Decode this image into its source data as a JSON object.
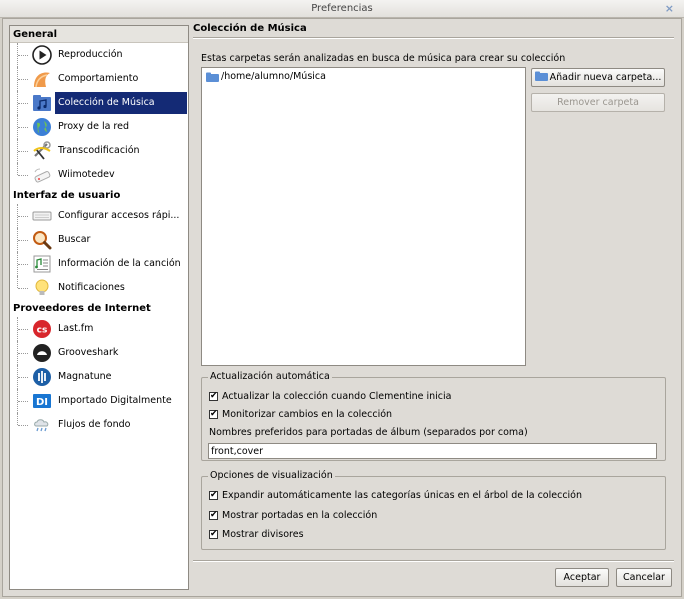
{
  "window": {
    "title": "Preferencias",
    "close_glyph": "×"
  },
  "sidebar": {
    "groups": [
      {
        "label": "General",
        "items": [
          {
            "label": "Reproducción",
            "icon": "play-icon"
          },
          {
            "label": "Comportamiento",
            "icon": "behaviour-icon"
          },
          {
            "label": "Colección de Música",
            "icon": "music-library-icon",
            "selected": true
          },
          {
            "label": "Proxy de la red",
            "icon": "globe-icon"
          },
          {
            "label": "Transcodificación",
            "icon": "transcode-icon"
          },
          {
            "label": "Wiimotedev",
            "icon": "wiimote-icon"
          }
        ]
      },
      {
        "label": "Interfaz de usuario",
        "items": [
          {
            "label": "Configurar accesos rápi...",
            "icon": "keyboard-icon"
          },
          {
            "label": "Buscar",
            "icon": "magnifier-icon"
          },
          {
            "label": "Información de la canción",
            "icon": "song-info-icon"
          },
          {
            "label": "Notificaciones",
            "icon": "lightbulb-icon"
          }
        ]
      },
      {
        "label": "Proveedores de Internet",
        "items": [
          {
            "label": "Last.fm",
            "icon": "lastfm-icon"
          },
          {
            "label": "Grooveshark",
            "icon": "grooveshark-icon"
          },
          {
            "label": "Magnatune",
            "icon": "magnatune-icon"
          },
          {
            "label": "Importado Digitalmente",
            "icon": "digitally-imported-icon"
          },
          {
            "label": "Flujos de fondo",
            "icon": "background-streams-icon"
          }
        ]
      }
    ]
  },
  "main": {
    "title": "Colección de Música",
    "description": "Estas carpetas serán analizadas en busca de música para crear su colección",
    "folders": [
      "/home/alumno/Música"
    ],
    "add_folder_button": "Añadir nueva carpeta...",
    "remove_folder_button": "Remover carpeta",
    "auto_update": {
      "legend": "Actualización automática",
      "update_on_start": {
        "label": "Actualizar la colección cuando Clementine inicia",
        "checked": true
      },
      "monitor_changes": {
        "label": "Monitorizar cambios en la colección",
        "checked": true
      },
      "cover_names_label": "Nombres preferidos para portadas de álbum (separados por coma)",
      "cover_names_value": "front,cover"
    },
    "display_options": {
      "legend": "Opciones de visualización",
      "expand_single": {
        "label": "Expandir automáticamente las categorías únicas en el árbol de la colección",
        "checked": true
      },
      "show_covers": {
        "label": "Mostrar portadas en la colección",
        "checked": true
      },
      "show_dividers": {
        "label": "Mostrar divisores",
        "checked": true
      }
    }
  },
  "footer": {
    "ok_button": "Aceptar",
    "cancel_button": "Cancelar"
  }
}
